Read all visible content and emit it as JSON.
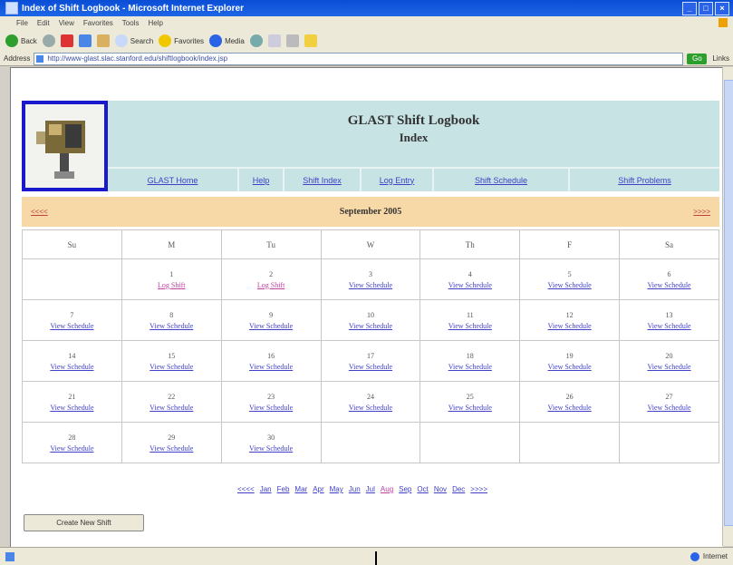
{
  "browser": {
    "title": "Index of Shift Logbook - Microsoft Internet Explorer",
    "menu": [
      "File",
      "Edit",
      "View",
      "Favorites",
      "Tools",
      "Help"
    ],
    "toolbar": {
      "back": "Back",
      "search": "Search",
      "favorites": "Favorites",
      "media": "Media"
    },
    "address_label": "Address",
    "address": "http://www-glast.slac.stanford.edu/shiftlogbook/index.jsp",
    "go": "Go",
    "links": "Links",
    "status_zone": "Internet"
  },
  "header": {
    "title": "GLAST Shift Logbook",
    "subtitle": "Index",
    "nav": [
      "GLAST Home",
      "Help",
      "Shift Index",
      "Log Entry",
      "Shift Schedule",
      "Shift Problems"
    ]
  },
  "month": {
    "prev": "<<<<",
    "title": "September 2005",
    "next": ">>>>"
  },
  "calendar": {
    "weekdays": [
      "Su",
      "M",
      "Tu",
      "W",
      "Th",
      "F",
      "Sa"
    ],
    "weeks": [
      [
        {
          "d": "",
          "l": ""
        },
        {
          "d": "1",
          "l": "Log Shift",
          "s": true
        },
        {
          "d": "2",
          "l": "Log Shift",
          "s": true
        },
        {
          "d": "3",
          "l": "View Schedule"
        },
        {
          "d": "4",
          "l": "View Schedule"
        },
        {
          "d": "5",
          "l": "View Schedule"
        },
        {
          "d": "6",
          "l": "View Schedule"
        }
      ],
      [
        {
          "d": "7",
          "l": "View Schedule"
        },
        {
          "d": "8",
          "l": "View Schedule"
        },
        {
          "d": "9",
          "l": "View Schedule"
        },
        {
          "d": "10",
          "l": "View Schedule"
        },
        {
          "d": "11",
          "l": "View Schedule"
        },
        {
          "d": "12",
          "l": "View Schedule"
        },
        {
          "d": "13",
          "l": "View Schedule"
        }
      ],
      [
        {
          "d": "14",
          "l": "View Schedule"
        },
        {
          "d": "15",
          "l": "View Schedule"
        },
        {
          "d": "16",
          "l": "View Schedule"
        },
        {
          "d": "17",
          "l": "View Schedule"
        },
        {
          "d": "18",
          "l": "View Schedule"
        },
        {
          "d": "19",
          "l": "View Schedule"
        },
        {
          "d": "20",
          "l": "View Schedule"
        }
      ],
      [
        {
          "d": "21",
          "l": "View Schedule"
        },
        {
          "d": "22",
          "l": "View Schedule"
        },
        {
          "d": "23",
          "l": "View Schedule"
        },
        {
          "d": "24",
          "l": "View Schedule"
        },
        {
          "d": "25",
          "l": "View Schedule"
        },
        {
          "d": "26",
          "l": "View Schedule"
        },
        {
          "d": "27",
          "l": "View Schedule"
        }
      ],
      [
        {
          "d": "28",
          "l": "View Schedule"
        },
        {
          "d": "29",
          "l": "View Schedule"
        },
        {
          "d": "30",
          "l": "View Schedule"
        },
        {
          "d": "",
          "l": ""
        },
        {
          "d": "",
          "l": ""
        },
        {
          "d": "",
          "l": ""
        },
        {
          "d": "",
          "l": ""
        }
      ]
    ]
  },
  "month_links": [
    "<<<<",
    "Jan",
    "Feb",
    "Mar",
    "Apr",
    "May",
    "Jun",
    "Jul",
    "Aug",
    "Sep",
    "Oct",
    "Nov",
    "Dec",
    ">>>>"
  ],
  "current_month": "Aug",
  "create_button": "Create New Shift"
}
